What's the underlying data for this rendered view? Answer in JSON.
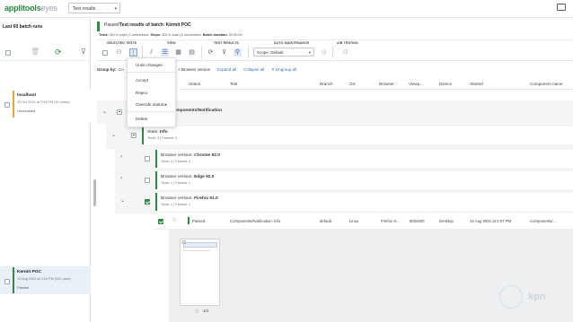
{
  "brand": {
    "name": "applitools",
    "suffix": "eyes"
  },
  "topbar": {
    "view_select": "Test results"
  },
  "left_panel": {
    "title": "Last 60 batch runs",
    "batches": [
      {
        "name": "localhost",
        "meta": "20 Oct 2021 at 3:33 PM  (16 unres)",
        "status": "Unresolved",
        "color": "#f0a030"
      },
      {
        "name": "Kermit POC",
        "meta": "13 Aug 2021 at 2:04 PM  (302 pass)",
        "status": "Passed",
        "color": "#2b8a3e"
      }
    ]
  },
  "batch": {
    "status": "Passed",
    "title": "Test results of batch: Kermit POC",
    "stats": {
      "tests_label": "Tests:",
      "tests_value": "302 in total",
      "unresolved": "| 0 unresolved",
      "steps_label": "Steps:",
      "steps_value": "302 in total",
      "unresolved2": "| 0 unresolved",
      "duration_label": "Batch duration:",
      "duration_value": "00:00:00"
    }
  },
  "toolbar": {
    "sections": {
      "selected_tests": "SELECTED TESTS",
      "view": "VIEW",
      "test_results": "TEST RESULTS",
      "auto_maintenance": "AUTO MAINTENANCE",
      "ab_testing": "A/B TESTING"
    },
    "scope": "Scope: Default"
  },
  "groupbar": {
    "label": "Group by:",
    "value": "Co",
    "crumb": "Browser version",
    "expand_all": "Expand all",
    "collapse_all": "Collapse all",
    "ungroup_all": "Ungroup all"
  },
  "columns": [
    "Status",
    "Test",
    "Branch",
    "OS",
    "Browser",
    "Viewp…",
    "Device",
    "Started",
    "Component name"
  ],
  "groups": {
    "component": "Components/Notification",
    "state": {
      "label": "State:",
      "value": "Info",
      "meta": "Tests: 4  |  Passed: 4"
    },
    "browsers": [
      {
        "label": "Browser version:",
        "value": "Chrome 92.0",
        "meta": "Tests: 4  |  Passed: 4"
      },
      {
        "label": "Browser version:",
        "value": "Edge 92.0",
        "meta": "Tests: 1  |  Passed: 1"
      },
      {
        "label": "Browser version:",
        "value": "Firefox 91.0",
        "meta": "Tests: 1  |  Passed: 1"
      }
    ]
  },
  "test_row": {
    "status": "Passed",
    "test": "Components/Notification: info",
    "branch": "default",
    "os": "Linux",
    "browser": "Firefox 9...",
    "viewport": "800x600",
    "device": "Desktop",
    "started": "13 Aug 2021 at 2:07 PM",
    "component": "Components/..."
  },
  "preview": {
    "counter": "1/1"
  },
  "dropdown": {
    "items": [
      "Undo changes",
      "Accept",
      "Reject",
      "Override status",
      "Delete"
    ]
  },
  "watermark": "kpn"
}
